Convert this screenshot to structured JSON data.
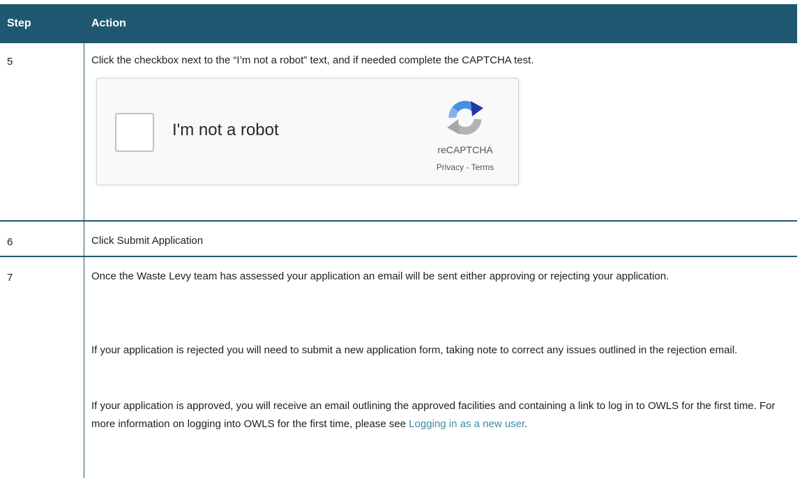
{
  "table": {
    "header": {
      "step": "Step",
      "action": "Action"
    },
    "rows": [
      {
        "step": "5",
        "action": "Click the checkbox next to the “I’m not a robot” text, and if needed complete the CAPTCHA test."
      },
      {
        "step": "6",
        "action": "Click Submit Application"
      },
      {
        "step": "7",
        "paragraphs": [
          "Once the Waste Levy team has assessed your application an email will be sent either approving or rejecting your application.",
          "If your application is rejected you will need to submit a new application form, taking note to correct any issues outlined in the rejection email.",
          "If your application is approved, you will receive an email outlining the approved facilities and containing a link to log in to OWLS for the first time. For more information on logging into OWLS for the first time, please see "
        ],
        "link_text": "Logging in as a new user",
        "link_suffix": "."
      }
    ]
  },
  "recaptcha": {
    "checkbox_label": "I'm not a robot",
    "brand": "reCAPTCHA",
    "privacy": "Privacy",
    "separator": " - ",
    "terms": "Terms"
  },
  "colors": {
    "header_bg": "#1f5870",
    "link": "#3b8aa6"
  },
  "icons": {
    "recaptcha_logo": "recaptcha-logo-icon"
  }
}
